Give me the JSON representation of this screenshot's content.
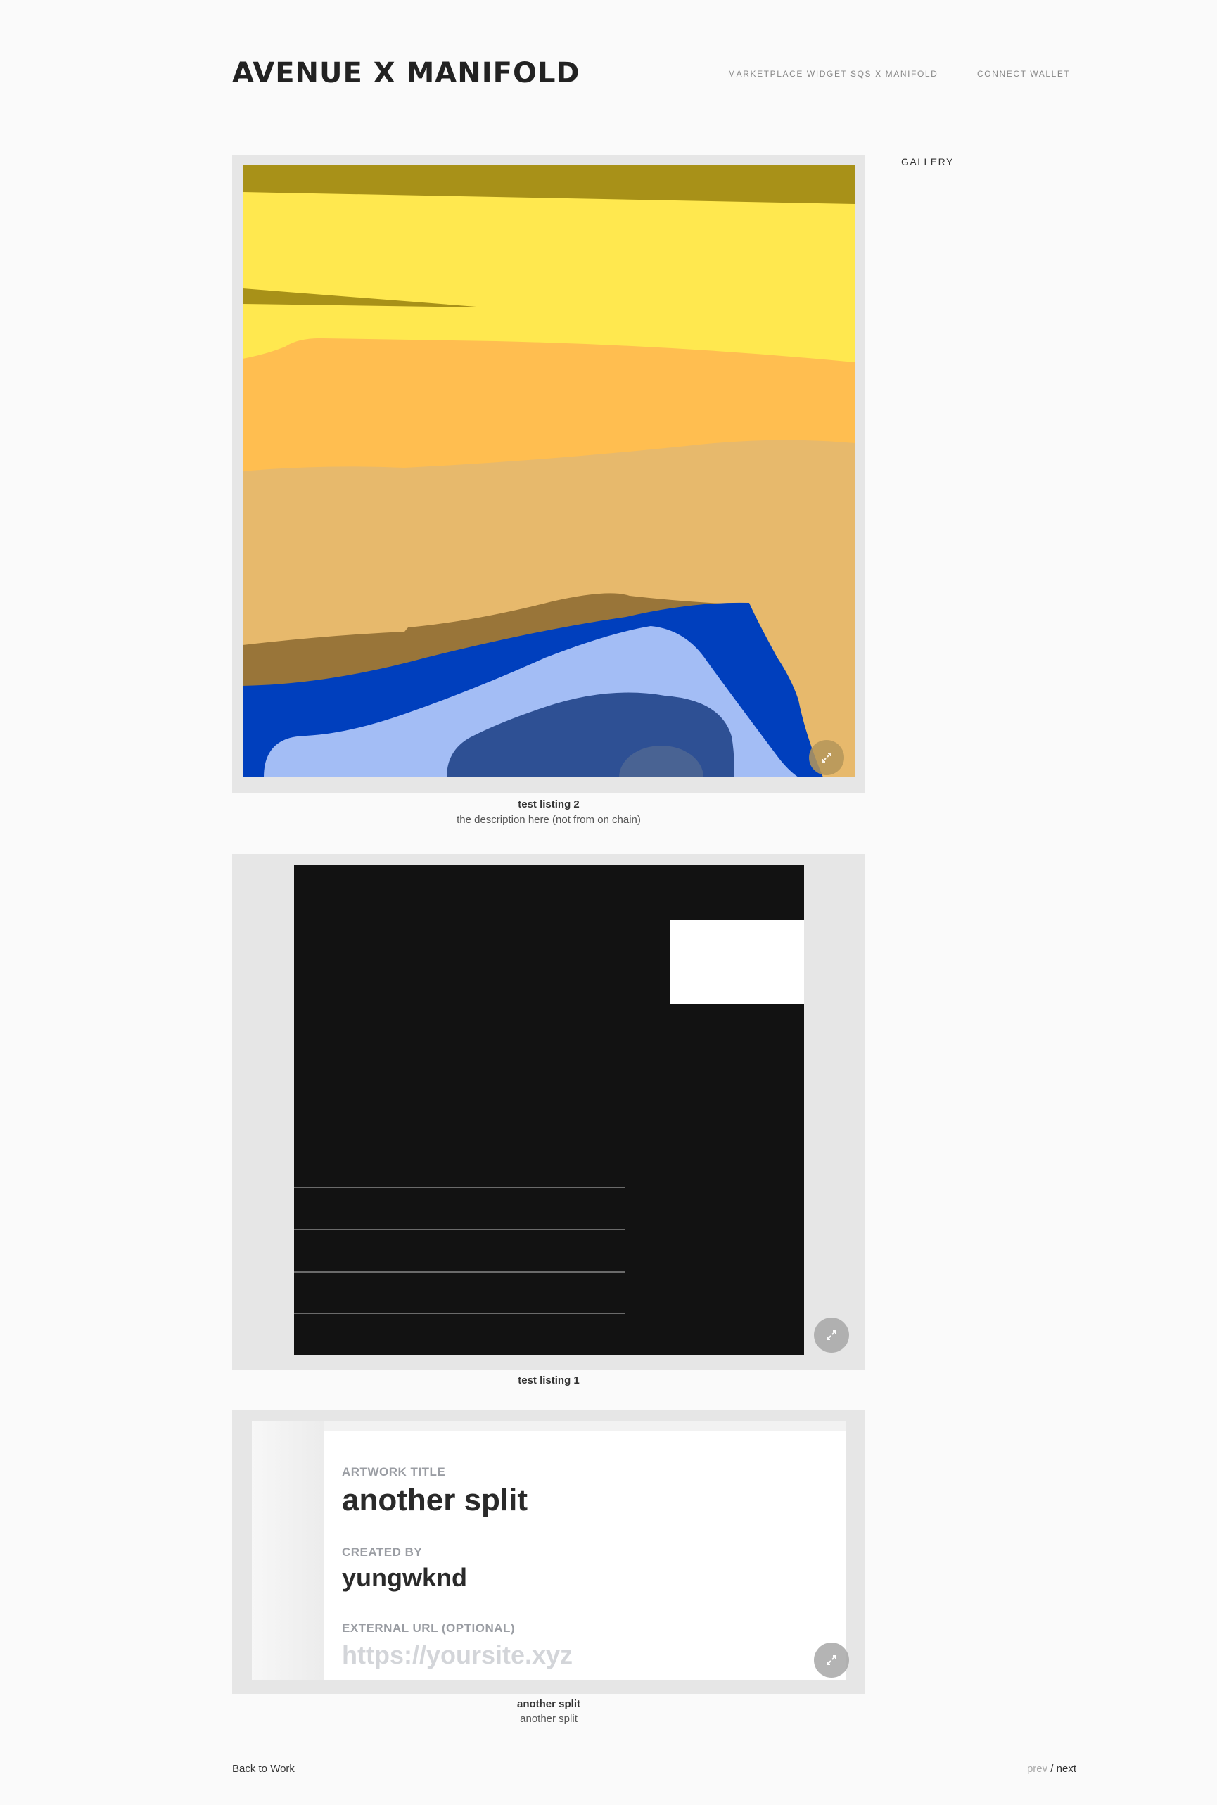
{
  "header": {
    "site_title": "AVENUE X MANIFOLD",
    "nav": [
      {
        "label": "MARKETPLACE WIDGET"
      },
      {
        "label": "SQS X MANIFOLD"
      },
      {
        "label": "CONNECT WALLET"
      }
    ]
  },
  "sidebar": {
    "gallery_label": "GALLERY"
  },
  "items": [
    {
      "title": "test listing 2",
      "description": "the description here (not from on chain)",
      "expand_icon": "expand-icon"
    },
    {
      "title": "test listing 1",
      "description": "",
      "expand_icon": "expand-icon"
    },
    {
      "title": "another split",
      "description": "another split",
      "expand_icon": "expand-icon",
      "form": {
        "artwork_title_label": "ARTWORK TITLE",
        "artwork_title_value": "another split",
        "created_by_label": "CREATED BY",
        "created_by_value": "yungwknd",
        "external_url_label": "EXTERNAL URL (OPTIONAL)",
        "external_url_placeholder": "https://yoursite.xyz"
      }
    }
  ],
  "footer": {
    "back_link": "Back to Work",
    "prev_label": "prev",
    "separator": "/",
    "next_label": "next"
  },
  "colors": {
    "background": "#fafafa",
    "frame": "#e6e6e6",
    "art_dark_gold": "#a89118",
    "art_yellow": "#ffe84f",
    "art_orange": "#ffbe50",
    "art_tan": "#e7b96c",
    "art_brown": "#997539",
    "art_blue": "#003fbd",
    "art_light_blue": "#a3bdf5",
    "art_navy": "#2e5094",
    "black_art": "#121212"
  }
}
